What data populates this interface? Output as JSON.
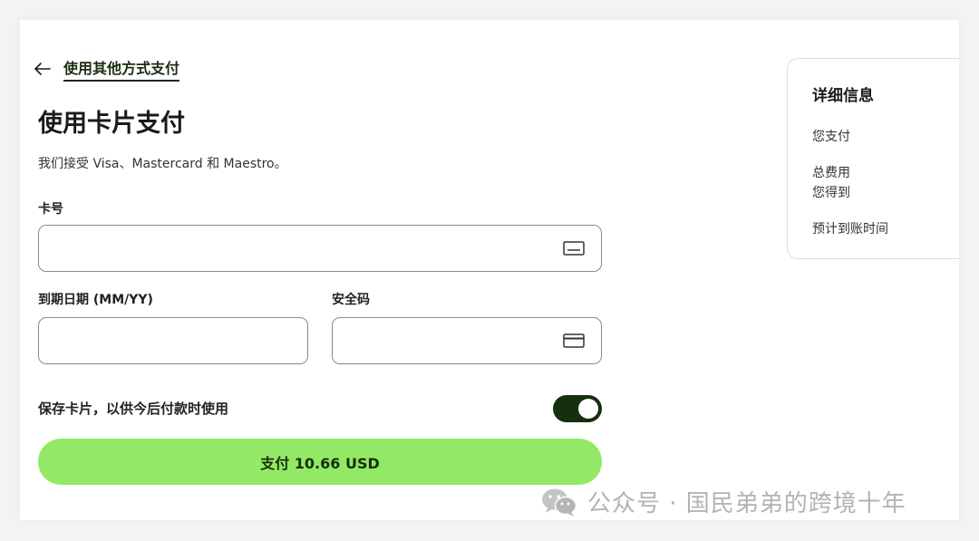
{
  "back_link": {
    "label": "使用其他方式支付",
    "icon": "arrow-left-icon"
  },
  "page": {
    "title": "使用卡片支付",
    "subtitle": "我们接受 Visa、Mastercard 和 Maestro。"
  },
  "form": {
    "card_number": {
      "label": "卡号",
      "value": "",
      "icon": "card-icon"
    },
    "expiry": {
      "label": "到期日期 (MM/YY)",
      "value": ""
    },
    "security_code": {
      "label": "安全码",
      "value": "",
      "icon": "card-back-icon"
    },
    "save_card": {
      "label": "保存卡片，以供今后付款时使用",
      "enabled": true
    },
    "pay_button": {
      "label": "支付 10.66 USD"
    }
  },
  "details": {
    "title": "详细信息",
    "you_pay": "您支付",
    "total_fee": "总费用",
    "you_get": "您得到",
    "estimated_arrival": "预计到账时间"
  },
  "watermark": {
    "text": "公众号 · 国民弟弟的跨境十年",
    "icon": "wechat-icon"
  },
  "colors": {
    "accent": "#93e965",
    "dark_green": "#15300e",
    "border": "#8a8a8a"
  }
}
